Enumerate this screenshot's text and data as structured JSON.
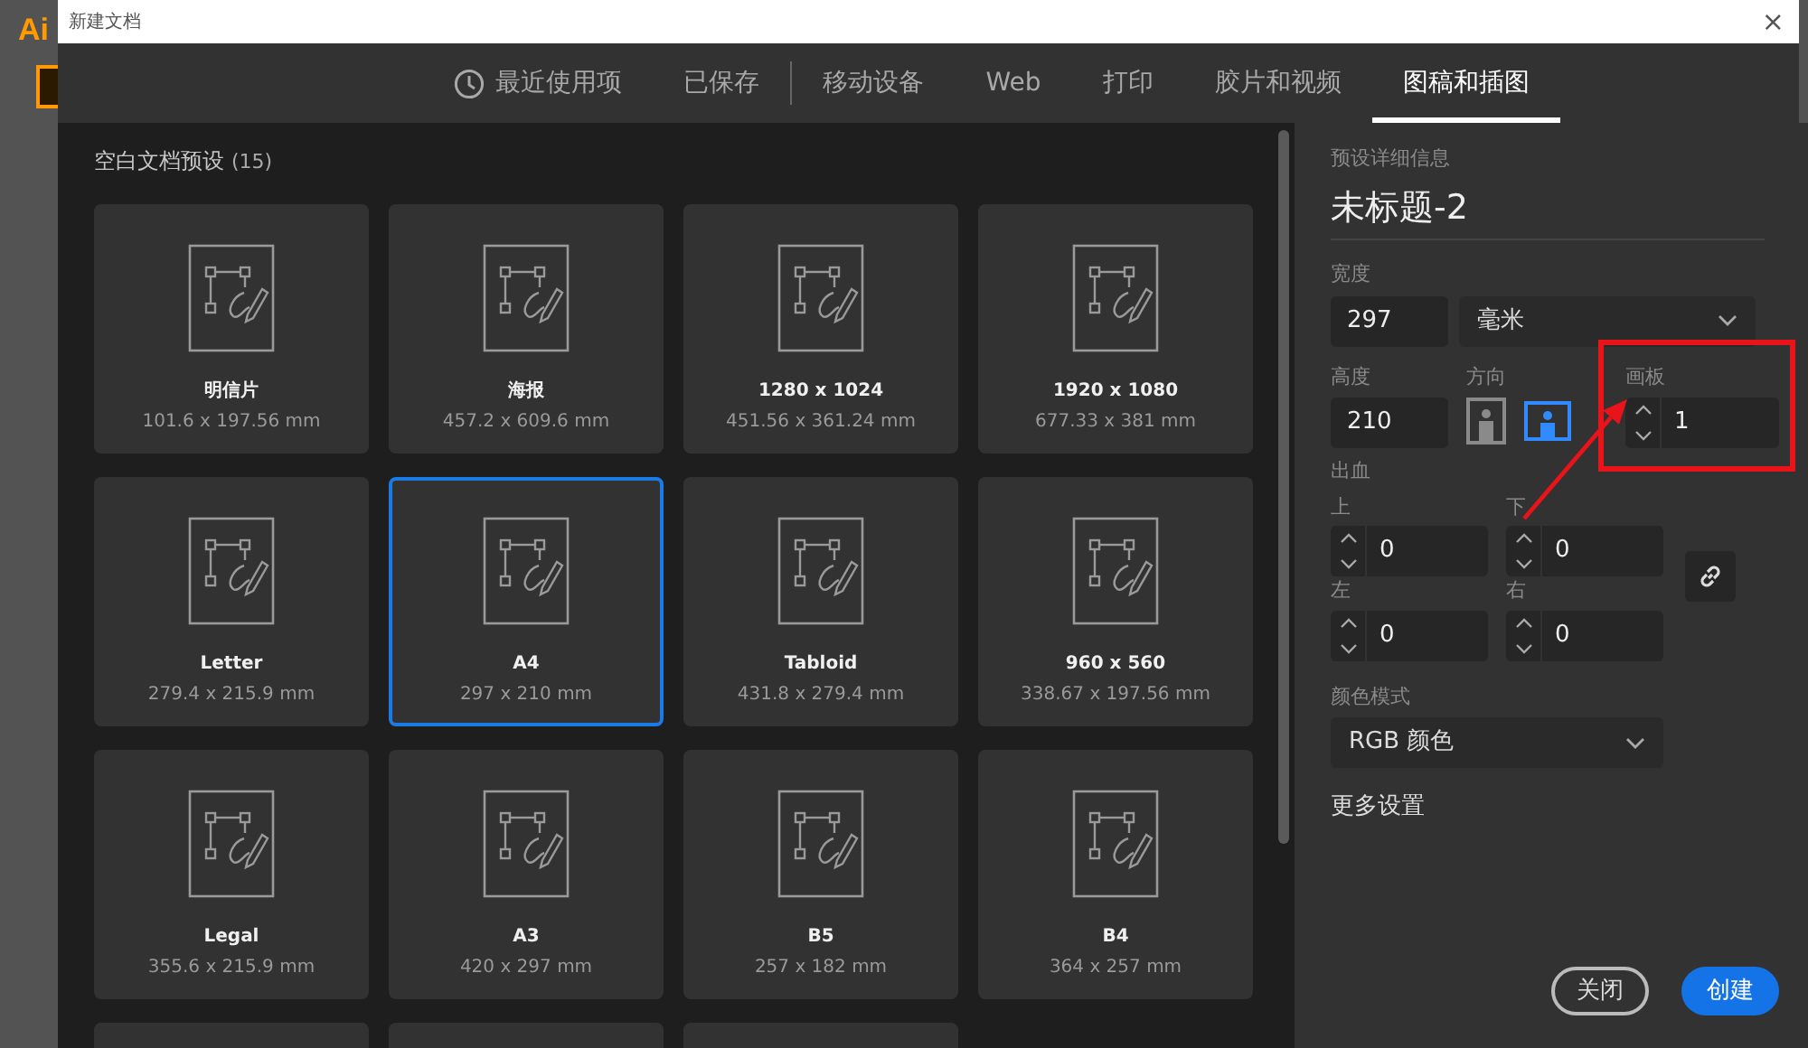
{
  "app": {
    "logo": "Ai"
  },
  "window": {
    "title": "新建文档",
    "close": "×"
  },
  "tabs": [
    {
      "label": "最近使用项",
      "kind": "with_icon",
      "selected": false,
      "divider_after": false
    },
    {
      "label": "已保存",
      "selected": false,
      "divider_after": true
    },
    {
      "label": "移动设备",
      "selected": false,
      "divider_after": false
    },
    {
      "label": "Web",
      "selected": false,
      "divider_after": false
    },
    {
      "label": "打印",
      "selected": false,
      "divider_after": false
    },
    {
      "label": "胶片和视频",
      "selected": false,
      "divider_after": false
    },
    {
      "label": "图稿和插图",
      "selected": true,
      "divider_after": false
    }
  ],
  "presets": {
    "title": "空白文档预设",
    "count": "(15)",
    "items": [
      {
        "kind": "full",
        "name": "明信片",
        "size": "101.6 x 197.56 mm",
        "selected": false
      },
      {
        "kind": "full",
        "name": "海报",
        "size": "457.2 x 609.6 mm",
        "selected": false
      },
      {
        "kind": "full",
        "name": "1280 x 1024",
        "size": "451.56 x 361.24 mm",
        "selected": false
      },
      {
        "kind": "full",
        "name": "1920 x 1080",
        "size": "677.33 x 381 mm",
        "selected": false
      },
      {
        "kind": "full",
        "name": "Letter",
        "size": "279.4 x 215.9 mm",
        "selected": false
      },
      {
        "kind": "full",
        "name": "A4",
        "size": "297 x 210 mm",
        "selected": true
      },
      {
        "kind": "full",
        "name": "Tabloid",
        "size": "431.8 x 279.4 mm",
        "selected": false
      },
      {
        "kind": "full",
        "name": "960 x 560",
        "size": "338.67 x 197.56 mm",
        "selected": false
      },
      {
        "kind": "full",
        "name": "Legal",
        "size": "355.6 x 215.9 mm",
        "selected": false
      },
      {
        "kind": "full",
        "name": "A3",
        "size": "420 x 297 mm",
        "selected": false
      },
      {
        "kind": "full",
        "name": "B5",
        "size": "257 x 182 mm",
        "selected": false
      },
      {
        "kind": "full",
        "name": "B4",
        "size": "364 x 257 mm",
        "selected": false
      },
      {
        "kind": "cut",
        "selected": false
      },
      {
        "kind": "cut",
        "selected": false
      },
      {
        "kind": "cut",
        "selected": false
      }
    ]
  },
  "details": {
    "heading": "预设详细信息",
    "name": "未标题-2",
    "width": {
      "label": "宽度",
      "value": "297"
    },
    "unit": {
      "value": "毫米"
    },
    "height": {
      "label": "高度",
      "value": "210"
    },
    "orientation": {
      "label": "方向",
      "options": [
        {
          "kind": "portrait",
          "selected": false
        },
        {
          "kind": "landscape",
          "selected": true
        }
      ]
    },
    "artboards": {
      "label": "画板",
      "value": "1"
    },
    "bleed": {
      "label": "出血",
      "fields": [
        {
          "label": "上",
          "value": "0"
        },
        {
          "label": "下",
          "value": "0"
        },
        {
          "label": "左",
          "value": "0"
        },
        {
          "label": "右",
          "value": "0"
        }
      ]
    },
    "color_mode": {
      "label": "颜色模式",
      "value": "RGB 颜色"
    },
    "more": "更多设置",
    "buttons": [
      {
        "label": "关闭",
        "kind": "secondary"
      },
      {
        "label": "创建",
        "kind": "primary"
      }
    ]
  }
}
